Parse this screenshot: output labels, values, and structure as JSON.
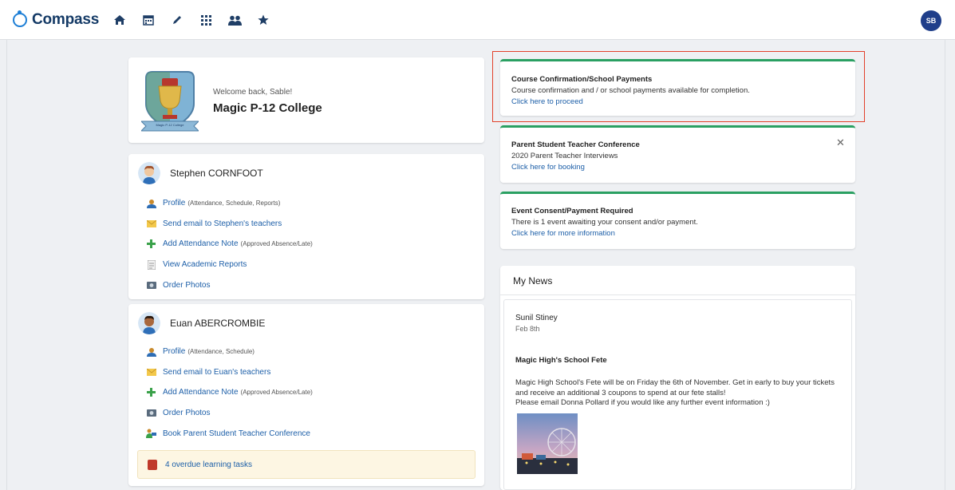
{
  "app": {
    "name": "Compass",
    "user_initials": "SB"
  },
  "nav": [
    "home-icon",
    "calendar-icon",
    "pencil-icon",
    "grid-icon",
    "people-icon",
    "star-icon"
  ],
  "school": {
    "welcome": "Welcome back, Sable!",
    "name": "Magic P-12 College",
    "crest_ribbon": "Magic P-12 College"
  },
  "students": [
    {
      "name": "Stephen CORNFOOT",
      "links": [
        {
          "icon": "profile-icon",
          "label": "Profile",
          "note": "(Attendance, Schedule, Reports)"
        },
        {
          "icon": "email-icon",
          "label": "Send email to Stephen's teachers",
          "note": ""
        },
        {
          "icon": "plus-icon",
          "label": "Add Attendance Note",
          "note": "(Approved Absence/Late)"
        },
        {
          "icon": "report-icon",
          "label": "View Academic Reports",
          "note": ""
        },
        {
          "icon": "camera-icon",
          "label": "Order Photos",
          "note": ""
        }
      ]
    },
    {
      "name": "Euan ABERCROMBIE",
      "links": [
        {
          "icon": "profile-icon",
          "label": "Profile",
          "note": "(Attendance, Schedule)"
        },
        {
          "icon": "email-icon",
          "label": "Send email to Euan's teachers",
          "note": ""
        },
        {
          "icon": "plus-icon",
          "label": "Add Attendance Note",
          "note": "(Approved Absence/Late)"
        },
        {
          "icon": "camera-icon",
          "label": "Order Photos",
          "note": ""
        },
        {
          "icon": "conference-icon",
          "label": "Book Parent Student Teacher Conference",
          "note": ""
        }
      ],
      "overdue": "4 overdue learning tasks"
    }
  ],
  "notices": [
    {
      "title": "Course Confirmation/School Payments",
      "text": "Course confirmation and / or school payments available for completion.",
      "link": "Click here to proceed"
    },
    {
      "title": "Parent Student Teacher Conference",
      "text": "2020 Parent Teacher Interviews",
      "link": "Click here for booking"
    },
    {
      "title": "Event Consent/Payment Required",
      "text": "There is 1 event awaiting your consent and/or payment.",
      "link": "Click here for more information"
    }
  ],
  "news": {
    "title": "My News",
    "author": "Sunil Stiney",
    "date": "Feb 8th",
    "headline": "Magic High's School Fete",
    "body_1": "Magic High School's Fete will be on Friday the 6th of November. Get in early to buy your tickets and receive an additional 3 coupons to spend at our fete stalls!",
    "body_2": "Please email Donna Pollard if you would like any further event information :)"
  },
  "colors": {
    "accent_green": "#2aa062",
    "link_blue": "#1d5fa8",
    "highlight_red": "#e2412b",
    "brand_navy": "#143a66"
  }
}
